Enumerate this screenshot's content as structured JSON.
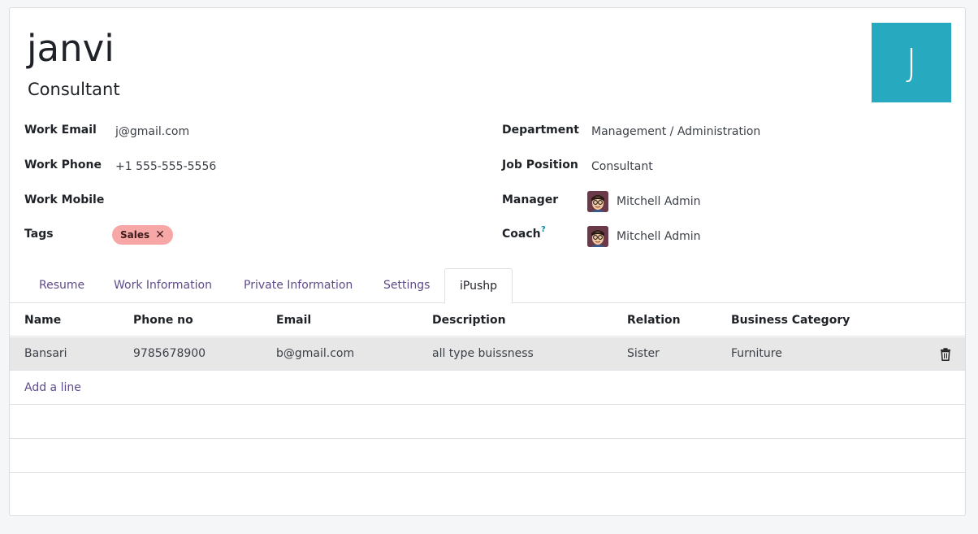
{
  "employee": {
    "name": "janvi",
    "job_title": "Consultant",
    "avatar_letter": "J",
    "avatar_color": "#27a9bf"
  },
  "fields_left": [
    {
      "label": "Work Email",
      "value": "j@gmail.com"
    },
    {
      "label": "Work Phone",
      "value": "+1 555-555-5556"
    },
    {
      "label": "Work Mobile",
      "value": ""
    },
    {
      "label": "Tags",
      "value": ""
    }
  ],
  "tags": [
    {
      "label": "Sales",
      "remove_icon": "✕",
      "color": "#f7a8a6"
    }
  ],
  "fields_right": [
    {
      "label": "Department",
      "value": "Management / Administration"
    },
    {
      "label": "Job Position",
      "value": "Consultant"
    },
    {
      "label": "Manager",
      "value": "Mitchell Admin",
      "icon": "user-avatar-icon"
    },
    {
      "label": "Coach",
      "value": "Mitchell Admin",
      "icon": "user-avatar-icon",
      "help": "?"
    }
  ],
  "tabs": [
    {
      "label": "Resume"
    },
    {
      "label": "Work Information"
    },
    {
      "label": "Private Information"
    },
    {
      "label": "Settings"
    },
    {
      "label": "iPushp",
      "active": true
    }
  ],
  "table": {
    "columns": [
      "Name",
      "Phone no",
      "Email",
      "Description",
      "Relation",
      "Business Category"
    ],
    "rows": [
      [
        "Bansari",
        "9785678900",
        "b@gmail.com",
        "all type buissness",
        "Sister",
        "Furniture"
      ]
    ],
    "delete_icon": "trash-icon",
    "add_line_label": "Add a line"
  }
}
